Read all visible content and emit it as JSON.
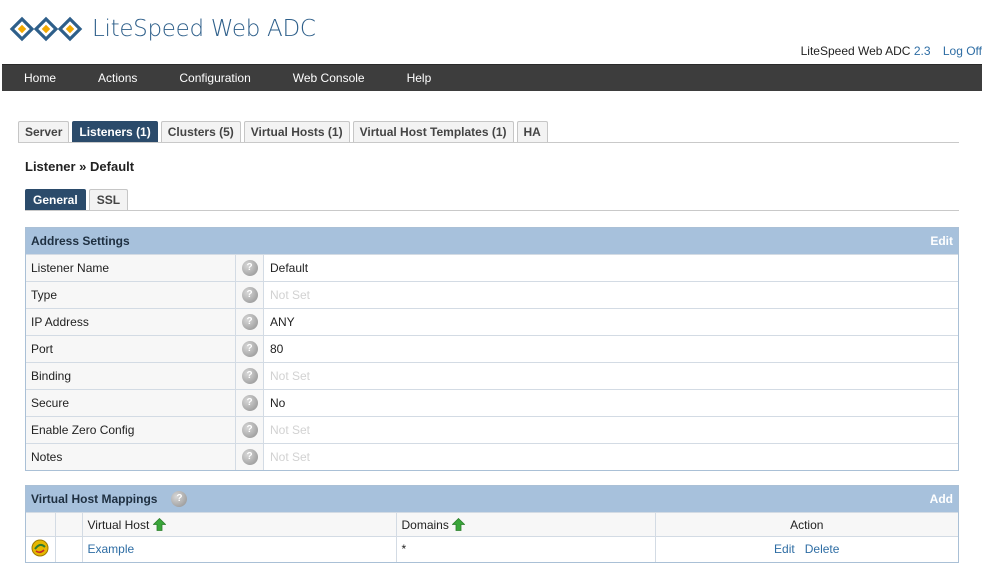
{
  "header": {
    "app_name": "LiteSpeed Web ADC",
    "product_label": "LiteSpeed Web ADC",
    "version": "2.3",
    "logoff_label": "Log Off"
  },
  "nav": {
    "items": [
      "Home",
      "Actions",
      "Configuration",
      "Web Console",
      "Help"
    ]
  },
  "tabs": [
    {
      "label": "Server",
      "active": false
    },
    {
      "label": "Listeners (1)",
      "active": true
    },
    {
      "label": "Clusters (5)",
      "active": false
    },
    {
      "label": "Virtual Hosts (1)",
      "active": false
    },
    {
      "label": "Virtual Host Templates (1)",
      "active": false
    },
    {
      "label": "HA",
      "active": false
    }
  ],
  "breadcrumb": "Listener » Default",
  "subtabs": [
    {
      "label": "General",
      "active": true
    },
    {
      "label": "SSL",
      "active": false
    }
  ],
  "address_settings": {
    "title": "Address Settings",
    "action": "Edit",
    "rows": [
      {
        "label": "Listener Name",
        "value": "Default",
        "notset": false
      },
      {
        "label": "Type",
        "value": "Not Set",
        "notset": true
      },
      {
        "label": "IP Address",
        "value": "ANY",
        "notset": false
      },
      {
        "label": "Port",
        "value": "80",
        "notset": false
      },
      {
        "label": "Binding",
        "value": "Not Set",
        "notset": true
      },
      {
        "label": "Secure",
        "value": "No",
        "notset": false
      },
      {
        "label": "Enable Zero Config",
        "value": "Not Set",
        "notset": true
      },
      {
        "label": "Notes",
        "value": "Not Set",
        "notset": true
      }
    ]
  },
  "vh_mappings": {
    "title": "Virtual Host Mappings",
    "action": "Add",
    "columns": {
      "virtual_host": "Virtual Host",
      "domains": "Domains",
      "action": "Action"
    },
    "rows": [
      {
        "virtual_host": "Example",
        "domains": "*",
        "edit": "Edit",
        "delete": "Delete"
      }
    ]
  },
  "help_glyph": "?",
  "colors": {
    "navbar": "#3d3d3d",
    "active_tab": "#2b4b6b",
    "panel_header": "#a7c1dc",
    "link": "#2e6da4",
    "sort_arrow": "#3aa63a"
  }
}
